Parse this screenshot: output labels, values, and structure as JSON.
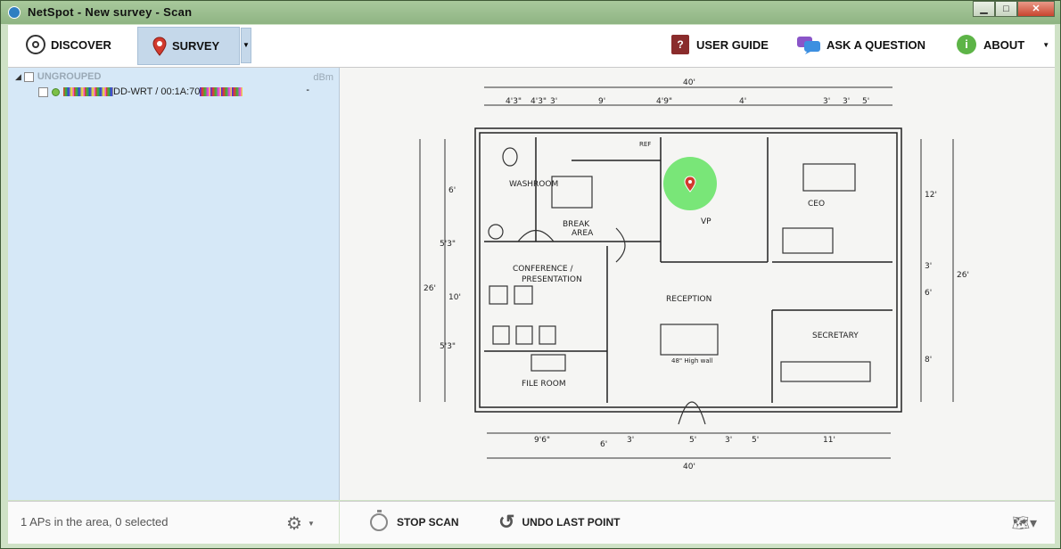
{
  "window": {
    "title": "NetSpot - New survey - Scan",
    "minimize": "▁",
    "maximize": "□",
    "close": "✕"
  },
  "toolbar": {
    "discover": "DISCOVER",
    "survey": "SURVEY",
    "user_guide": "USER GUIDE",
    "ask_question": "ASK A QUESTION",
    "about": "ABOUT"
  },
  "sidebar": {
    "group_label": "UNGROUPED",
    "unit": "dBm",
    "ap": {
      "name": "DD-WRT / 00:1A:70",
      "value": "-"
    },
    "status": "1 APs in the area, 0 selected"
  },
  "floorplan": {
    "rooms": [
      "WASHROOM",
      "BREAK",
      "AREA",
      "VP",
      "CEO",
      "CONFERENCE /",
      "PRESENTATION",
      "RECEPTION",
      "SECRETARY",
      "FILE ROOM",
      "REF",
      "48\" High wall"
    ],
    "dims_top": [
      "40'",
      "4'3\"",
      "4'3\"",
      "3'",
      "9'",
      "4'9\"",
      "4'",
      "3'",
      "3'",
      "5'"
    ],
    "dims_left": [
      "26'",
      "10'",
      "6'",
      "5'3\"",
      "5'3\""
    ],
    "dims_right": [
      "26'",
      "12'",
      "8'",
      "3'",
      "6'"
    ],
    "dims_bottom": [
      "40'",
      "9'6\"",
      "6'",
      "3'",
      "5'",
      "3'",
      "5'",
      "11'"
    ]
  },
  "bottom": {
    "stop_scan": "STOP SCAN",
    "undo_last_point": "UNDO LAST POINT"
  },
  "colors": {
    "coverage": "#4fe04f",
    "selected_tool": "#c5d8ea",
    "sidebar_bg": "#d6e8f7"
  }
}
